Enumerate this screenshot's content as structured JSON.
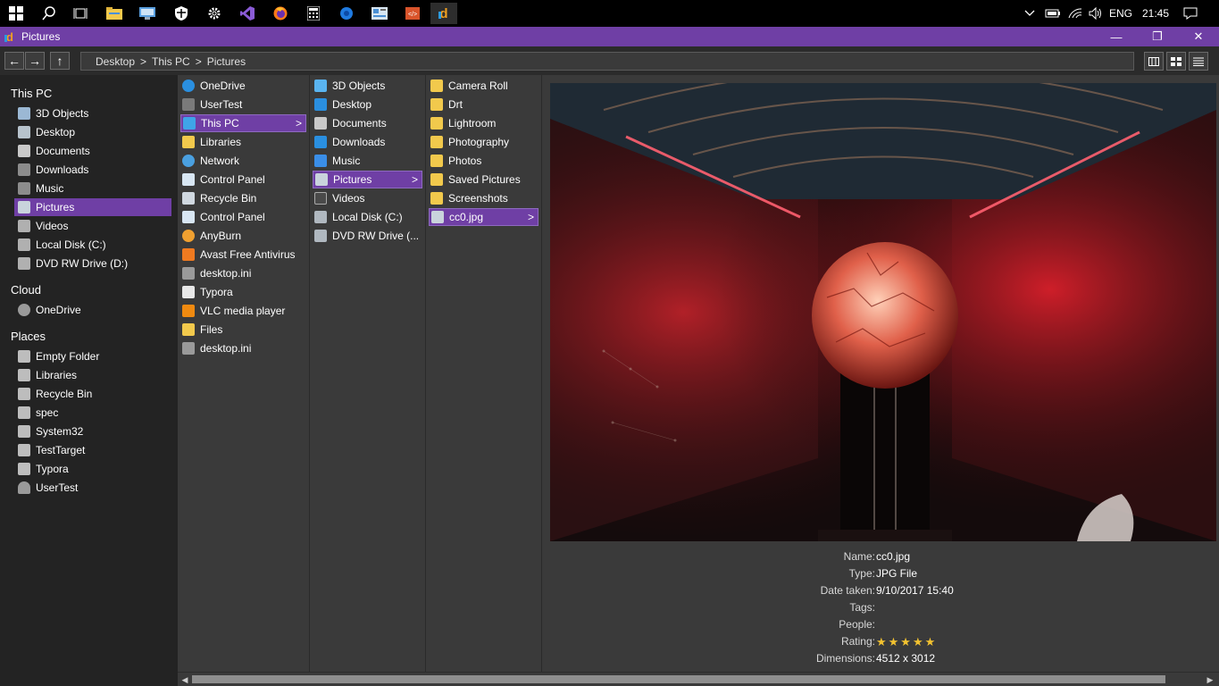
{
  "taskbar": {
    "language": "ENG",
    "time": "21:45",
    "icons": [
      "windows-start",
      "search",
      "task-view",
      "file-explorer",
      "remote-desktop",
      "windows-security",
      "settings",
      "visual-studio",
      "firefox",
      "calculator",
      "edge-blue",
      "control-panel",
      "code-editor",
      "d-app"
    ]
  },
  "window": {
    "title": "Pictures",
    "accent": "#6f3fa5",
    "minimize": "—",
    "maximize": "❐",
    "close": "✕"
  },
  "toolbar": {
    "back": "←",
    "forward": "→",
    "up": "↑",
    "breadcrumb": [
      "Desktop",
      "This PC",
      "Pictures"
    ],
    "separator": ">"
  },
  "sidebar": {
    "this_pc_label": "This PC",
    "this_pc_items": [
      "3D Objects",
      "Desktop",
      "Documents",
      "Downloads",
      "Music",
      "Pictures",
      "Videos",
      "Local Disk (C:)",
      "DVD RW Drive (D:)"
    ],
    "selected": "Pictures",
    "cloud_label": "Cloud",
    "cloud_items": [
      "OneDrive"
    ],
    "places_label": "Places",
    "places_items": [
      "Empty Folder",
      "Libraries",
      "Recycle Bin",
      "spec",
      "System32",
      "TestTarget",
      "Typora",
      "UserTest"
    ]
  },
  "columns": {
    "col1": [
      "OneDrive",
      "UserTest",
      "This PC",
      "Libraries",
      "Network",
      "Control Panel",
      "Recycle Bin",
      "Control Panel",
      "AnyBurn",
      "Avast Free Antivirus",
      "desktop.ini",
      "Typora",
      "VLC media player",
      "Files",
      "desktop.ini"
    ],
    "col1_selected": "This PC",
    "col2": [
      "3D Objects",
      "Desktop",
      "Documents",
      "Downloads",
      "Music",
      "Pictures",
      "Videos",
      "Local Disk (C:)",
      "DVD RW Drive (..."
    ],
    "col2_selected": "Pictures",
    "col3": [
      "Camera Roll",
      "Drt",
      "Lightroom",
      "Photography",
      "Photos",
      "Saved Pictures",
      "Screenshots",
      "cc0.jpg"
    ],
    "col3_selected": "cc0.jpg",
    "chevron": ">"
  },
  "preview": {
    "properties": [
      {
        "label": "Name:",
        "value": "cc0.jpg"
      },
      {
        "label": "Type:",
        "value": "JPG File"
      },
      {
        "label": "Date taken:",
        "value": "9/10/2017 15:40"
      },
      {
        "label": "Tags:",
        "value": ""
      },
      {
        "label": "People:",
        "value": ""
      },
      {
        "label": "Rating:",
        "value": "★★★★★"
      },
      {
        "label": "Dimensions:",
        "value": "4512 x 3012"
      }
    ],
    "rating": 5
  }
}
